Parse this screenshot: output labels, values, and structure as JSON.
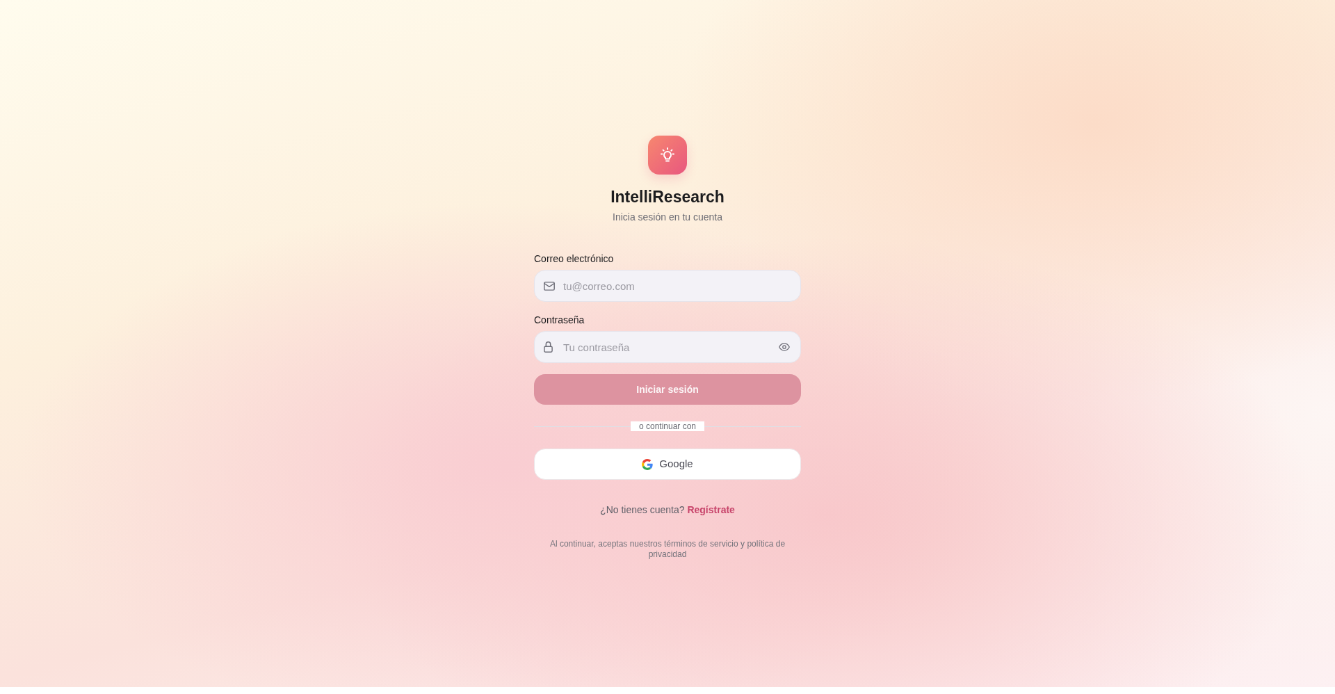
{
  "brand": {
    "name": "IntelliResearch",
    "subtitle": "Inicia sesión en tu cuenta"
  },
  "fields": [
    {
      "kind": "email",
      "label": "Correo electrónico",
      "placeholder": "tu@correo.com"
    },
    {
      "kind": "password",
      "label": "Contraseña",
      "placeholder": "Tu contraseña"
    }
  ],
  "submit_button": {
    "label": "Iniciar sesión",
    "disabled": true
  },
  "divider": {
    "label": "o continuar con"
  },
  "social_buttons": [
    {
      "kind": "google",
      "label": "Google"
    }
  ],
  "signup_prompt": {
    "text": "¿No tienes cuenta?",
    "link": "Regístrate"
  },
  "legal_note": "Al continuar, aceptas nuestros términos de servicio y política de privacidad"
}
